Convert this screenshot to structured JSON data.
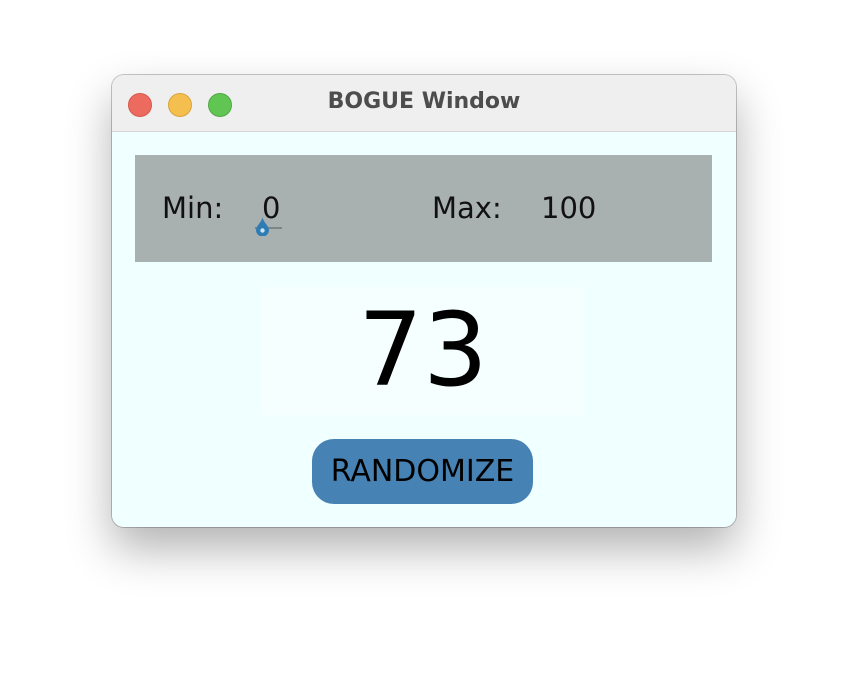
{
  "window": {
    "title": "BOGUE Window"
  },
  "controls": {
    "min_label": "Min:",
    "min_value": "0",
    "min_slider_level": 0,
    "max_label": "Max:",
    "max_value": "100"
  },
  "result": {
    "value": "73"
  },
  "actions": {
    "randomize_label": "RANDOMIZE"
  },
  "colors": {
    "window_bg": "#f0ffff",
    "panel_bg": "#a9b0b0",
    "button_bg": "#4682b4",
    "slider_thumb": "#2f7cb4",
    "close": "#ed6a5e",
    "minimize": "#f5bf4f",
    "maximize": "#61c554"
  },
  "icons": {
    "close": "close-traffic-light-icon",
    "minimize": "minimize-traffic-light-icon",
    "maximize": "maximize-traffic-light-icon",
    "slider_thumb": "slider-thumb-icon"
  }
}
